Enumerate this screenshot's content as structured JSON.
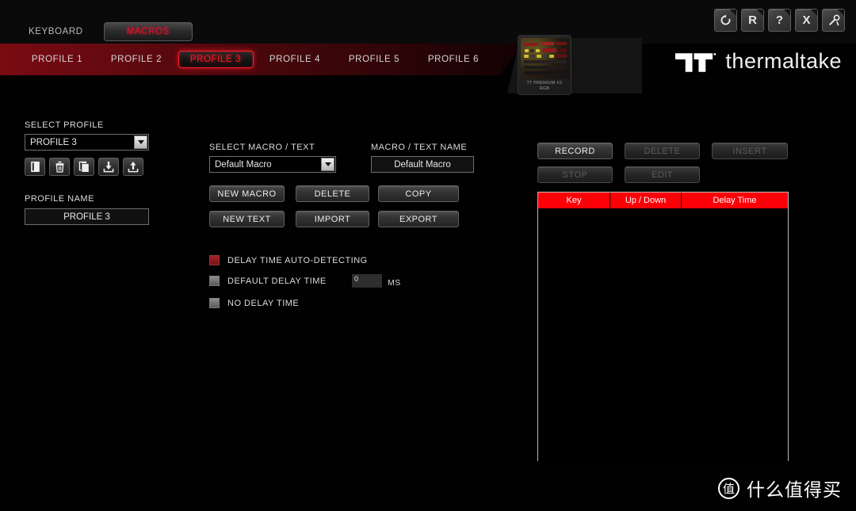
{
  "app": {
    "title": "Thermaltake TT Premium X1 RGB — Macros",
    "brand_word": "thermaltake",
    "accent_red": "#e8112d",
    "table_header_red": "#fb0007"
  },
  "topbar": {
    "mode_tabs": [
      {
        "label": "KEYBOARD",
        "active": false
      },
      {
        "label": "MACROS",
        "active": true
      }
    ],
    "window_buttons": [
      {
        "icon": "refresh-icon",
        "glyph": "↺"
      },
      {
        "icon": "r-letter-icon",
        "glyph": "R"
      },
      {
        "icon": "help-icon",
        "glyph": "?"
      },
      {
        "icon": "close-icon",
        "glyph": "X"
      },
      {
        "icon": "tools-icon",
        "glyph": "⚒"
      }
    ]
  },
  "profile_tabs": [
    {
      "label": "PROFILE 1",
      "active": false
    },
    {
      "label": "PROFILE 2",
      "active": false
    },
    {
      "label": "PROFILE 3",
      "active": true
    },
    {
      "label": "PROFILE 4",
      "active": false
    },
    {
      "label": "PROFILE 5",
      "active": false
    },
    {
      "label": "PROFILE 6",
      "active": false
    }
  ],
  "device": {
    "name_line1": "TT PREMIUM X1",
    "name_line2": "RGB"
  },
  "profile_panel": {
    "select_profile_label": "SELECT PROFILE",
    "select_profile_value": "PROFILE 3",
    "icon_buttons": [
      {
        "name": "new-profile-icon"
      },
      {
        "name": "delete-profile-icon"
      },
      {
        "name": "copy-profile-icon"
      },
      {
        "name": "import-profile-icon"
      },
      {
        "name": "export-profile-icon"
      }
    ],
    "profile_name_label": "PROFILE NAME",
    "profile_name_value": "PROFILE 3"
  },
  "macro_panel": {
    "select_macro_label": "SELECT MACRO / TEXT",
    "select_macro_value": "Default Macro",
    "macro_name_label": "MACRO / TEXT NAME",
    "macro_name_value": "Default Macro",
    "buttons": [
      {
        "label": "NEW MACRO",
        "disabled": false
      },
      {
        "label": "DELETE",
        "disabled": false
      },
      {
        "label": "COPY",
        "disabled": false
      },
      {
        "label": "NEW TEXT",
        "disabled": false
      },
      {
        "label": "IMPORT",
        "disabled": false
      },
      {
        "label": "EXPORT",
        "disabled": false
      }
    ],
    "delay_options": [
      {
        "label": "DELAY TIME AUTO-DETECTING",
        "checked": true
      },
      {
        "label": "DEFAULT DELAY TIME",
        "checked": false
      },
      {
        "label": "NO DELAY TIME",
        "checked": false
      }
    ],
    "default_delay_value": "0",
    "delay_unit": "MS"
  },
  "record_panel": {
    "buttons": [
      {
        "label": "RECORD",
        "disabled": false
      },
      {
        "label": "DELETE",
        "disabled": true
      },
      {
        "label": "INSERT",
        "disabled": true
      },
      {
        "label": "STOP",
        "disabled": true
      },
      {
        "label": "EDIT",
        "disabled": true
      }
    ],
    "table": {
      "columns": [
        "Key",
        "Up / Down",
        "Delay Time"
      ],
      "rows": []
    }
  },
  "watermark": {
    "badge": "值",
    "text": "什么值得买"
  }
}
